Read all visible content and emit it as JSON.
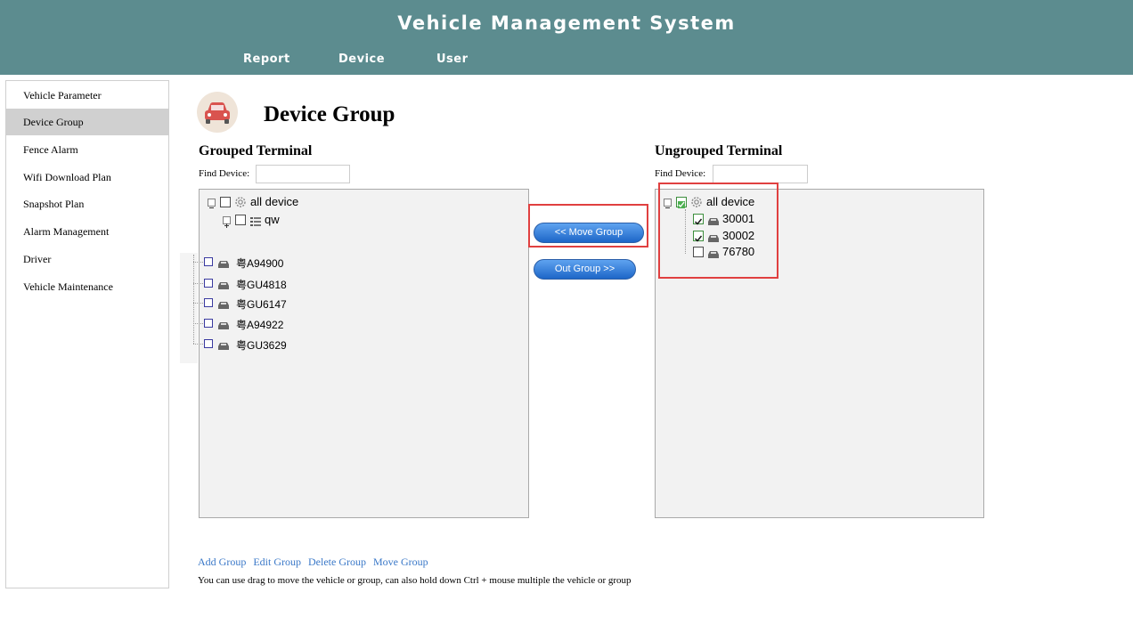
{
  "app": {
    "title": "Vehicle Management System"
  },
  "nav": {
    "items": [
      "Report",
      "Device",
      "User"
    ]
  },
  "sidebar": {
    "items": [
      {
        "label": "Vehicle Parameter",
        "active": false
      },
      {
        "label": "Device Group",
        "active": true
      },
      {
        "label": "Fence Alarm",
        "active": false
      },
      {
        "label": "Wifi Download Plan",
        "active": false
      },
      {
        "label": "Snapshot Plan",
        "active": false
      },
      {
        "label": "Alarm Management",
        "active": false
      },
      {
        "label": "Driver",
        "active": false
      },
      {
        "label": "Vehicle Maintenance",
        "active": false
      }
    ]
  },
  "page": {
    "title": "Device Group",
    "icon": "car-icon"
  },
  "grouped": {
    "title": "Grouped Terminal",
    "find_label": "Find Device:",
    "find_value": "",
    "root_label": "all device",
    "group_label": "qw",
    "vehicles": [
      "粤A94900",
      "粤GU4818",
      "粤GU6147",
      "粤A94922",
      "粤GU3629"
    ]
  },
  "ungrouped": {
    "title": "Ungrouped Terminal",
    "find_label": "Find Device:",
    "find_value": "",
    "root_label": "all device",
    "root_checked": true,
    "devices": [
      {
        "label": "30001",
        "checked": true
      },
      {
        "label": "30002",
        "checked": true
      },
      {
        "label": "76780",
        "checked": false
      }
    ]
  },
  "buttons": {
    "move_group": "<< Move Group",
    "out_group": "Out Group >>"
  },
  "footer": {
    "links": [
      "Add Group",
      "Edit Group",
      "Delete Group",
      "Move Group"
    ],
    "hint": "You can use drag to move the vehicle or group, can also hold down Ctrl + mouse multiple the vehicle or group"
  },
  "colors": {
    "header": "#5c8c8f",
    "highlight": "#e04040",
    "button": "#1d66c7",
    "link": "#3a78c8"
  }
}
